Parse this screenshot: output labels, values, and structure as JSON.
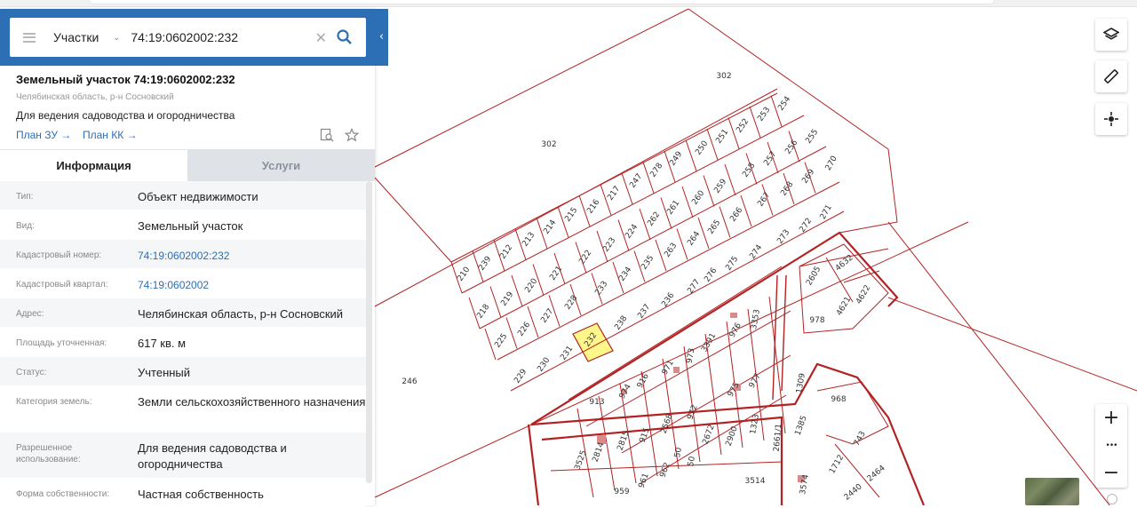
{
  "search": {
    "layer": "Участки",
    "query": "74:19:0602002:232"
  },
  "card": {
    "title": "Земельный участок 74:19:0602002:232",
    "subtitle": "Челябинская область, р-н Сосновский",
    "purpose": "Для ведения садоводства и огородничества",
    "plan_zu": "План ЗУ →",
    "plan_kk": "План КК →"
  },
  "tabs": [
    {
      "label": "Информация",
      "active": true
    },
    {
      "label": "Услуги",
      "active": false
    }
  ],
  "info_rows": [
    {
      "key": "Тип:",
      "value": "Объект недвижимости"
    },
    {
      "key": "Вид:",
      "value": "Земельный участок"
    },
    {
      "key": "Кадастровый номер:",
      "value": "74:19:0602002:232"
    },
    {
      "key": "Кадастровый квартал:",
      "value": "74:19:0602002"
    },
    {
      "key": "Адрес:",
      "value": "Челябинская область, р-н Сосновский"
    },
    {
      "key": "Площадь уточненная:",
      "value": "617 кв. м"
    },
    {
      "key": "Статус:",
      "value": "Учтенный"
    },
    {
      "key": "Категория земель:",
      "value": "Земли сельскохозяйственного назначения"
    },
    {
      "key": "Разрешенное использование:",
      "value": "Для ведения садоводства и огородничества"
    },
    {
      "key": "Форма собственности:",
      "value": "Частная собственность"
    }
  ],
  "map": {
    "selected_plot": "232",
    "highlight_color": "#fff78a",
    "line_color": "#b22222",
    "plot_labels": [
      "302",
      "302",
      "246",
      "254",
      "253",
      "252",
      "251",
      "250",
      "249",
      "278",
      "247",
      "217",
      "216",
      "215",
      "214",
      "213",
      "212",
      "239",
      "210",
      "255",
      "256",
      "257",
      "258",
      "270",
      "269",
      "268",
      "267",
      "260",
      "259",
      "266",
      "261",
      "262",
      "224",
      "223",
      "222",
      "221",
      "220",
      "219",
      "218",
      "271",
      "272",
      "273",
      "274",
      "275",
      "276",
      "277",
      "236",
      "235",
      "234",
      "233",
      "228",
      "227",
      "226",
      "225",
      "263",
      "264",
      "265",
      "238",
      "237",
      "232",
      "231",
      "230",
      "229",
      "4632",
      "2605",
      "4622",
      "4621",
      "978",
      "3353",
      "976",
      "3391",
      "973",
      "971",
      "916",
      "974",
      "913",
      "975",
      "977",
      "972",
      "2568",
      "915",
      "2815",
      "2814",
      "3525",
      "2672",
      "2900",
      "1323",
      "1309",
      "968",
      "1385",
      "743",
      "1712",
      "2464",
      "2440",
      "3574",
      "3514",
      "962",
      "961",
      "959",
      "50",
      "50",
      "2661/1"
    ]
  },
  "controls": {
    "layers_icon": "layers-icon",
    "ruler_icon": "ruler-icon",
    "locate_icon": "crosshair-icon",
    "zoom_in": "+",
    "more": "•••",
    "zoom_out": "−"
  }
}
